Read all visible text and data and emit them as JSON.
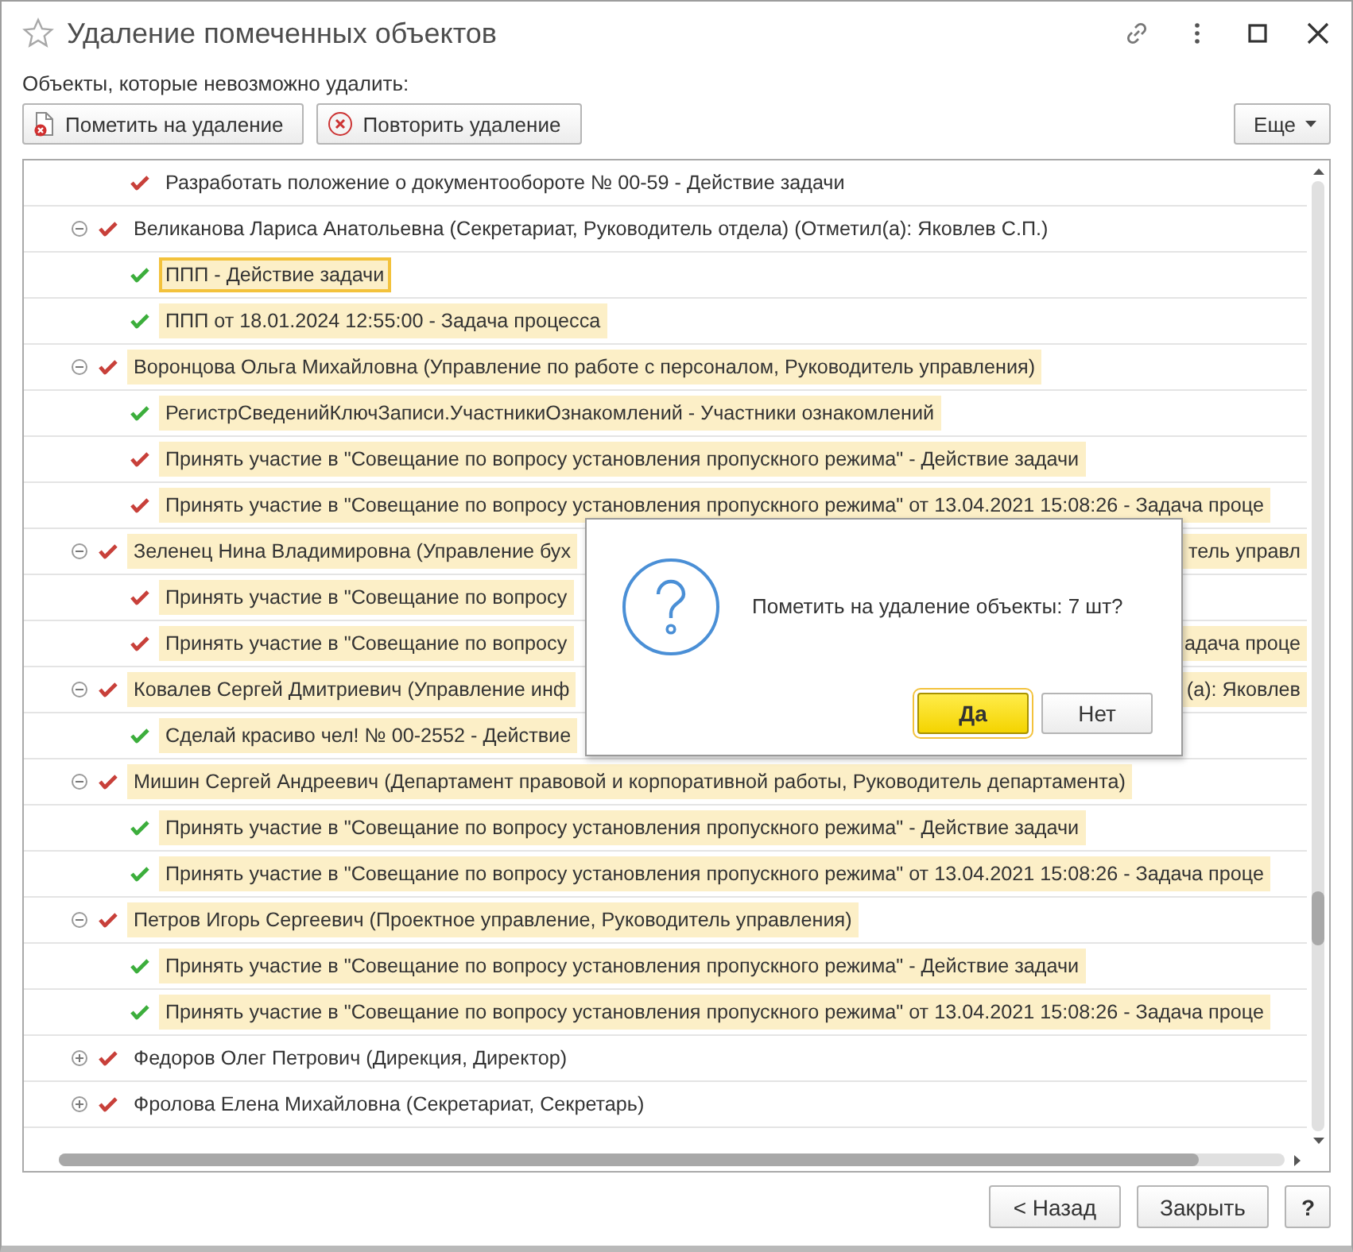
{
  "window": {
    "title": "Удаление помеченных объектов"
  },
  "section_label": "Объекты, которые невозможно удалить:",
  "toolbar": {
    "buttons": [
      {
        "label": "Пометить на удаление",
        "kind": "mark"
      },
      {
        "label": "Повторить удаление",
        "kind": "retry"
      }
    ],
    "more": "Еще"
  },
  "tree": {
    "continued_children": [
      {
        "text": "Разработать положение о документообороте № 00-59 - Действие задачи",
        "color": "#c8403a",
        "highlighted": false,
        "selected": false
      }
    ],
    "items": [
      {
        "text": "Великанова Лариса Анатольевна (Секретариат, Руководитель отдела) (Отметил(а): Яковлев С.П.)",
        "color": "#c8403a",
        "highlighted": false,
        "selected": false,
        "expanded": true,
        "children": [
          {
            "text": "ППП - Действие задачи",
            "color": "#3cae3c",
            "highlighted": true,
            "selected": true
          },
          {
            "text": "ППП от 18.01.2024 12:55:00 - Задача процесса",
            "color": "#3cae3c",
            "highlighted": true,
            "selected": false
          }
        ]
      },
      {
        "text": "Воронцова Ольга Михайловна (Управление по работе с персоналом, Руководитель управления)",
        "color": "#c8403a",
        "highlighted": true,
        "selected": false,
        "expanded": true,
        "children": [
          {
            "text": "РегистрСведенийКлючЗаписи.УчастникиОзнакомлений - Участники ознакомлений",
            "color": "#3cae3c",
            "highlighted": true,
            "selected": false
          },
          {
            "text": "Принять участие в \"Совещание по вопросу установления пропускного режима\" - Действие задачи",
            "color": "#c8403a",
            "highlighted": true,
            "selected": false
          },
          {
            "text": "Принять участие в \"Совещание по вопросу установления пропускного режима\" от 13.04.2021 15:08:26 - Задача проце",
            "color": "#c8403a",
            "highlighted": true,
            "selected": false
          }
        ]
      },
      {
        "text": "Зеленец Нина Владимировна (Управление бух",
        "text_right": "тель управл",
        "color": "#c8403a",
        "highlighted": true,
        "selected": false,
        "expanded": true,
        "children": [
          {
            "text": "Принять участие в \"Совещание по вопросу",
            "color": "#c8403a",
            "highlighted": true,
            "selected": false
          },
          {
            "text": "Принять участие в \"Совещание по вопросу",
            "text_right": "адача проце",
            "color": "#c8403a",
            "highlighted": true,
            "selected": false
          }
        ]
      },
      {
        "text": "Ковалев Сергей Дмитриевич (Управление инф",
        "text_right": "(а): Яковлев",
        "color": "#c8403a",
        "highlighted": true,
        "selected": false,
        "expanded": true,
        "children": [
          {
            "text": "Сделай красиво чел! № 00-2552 - Действие",
            "color": "#3cae3c",
            "highlighted": true,
            "selected": false
          }
        ]
      },
      {
        "text": "Мишин Сергей Андреевич (Департамент правовой и корпоративной работы, Руководитель департамента)",
        "color": "#c8403a",
        "highlighted": true,
        "selected": false,
        "expanded": true,
        "children": [
          {
            "text": "Принять участие в \"Совещание по вопросу установления пропускного режима\" - Действие задачи",
            "color": "#3cae3c",
            "highlighted": true,
            "selected": false
          },
          {
            "text": "Принять участие в \"Совещание по вопросу установления пропускного режима\" от 13.04.2021 15:08:26 - Задача проце",
            "color": "#3cae3c",
            "highlighted": true,
            "selected": false
          }
        ]
      },
      {
        "text": "Петров Игорь Сергеевич (Проектное управление, Руководитель управления)",
        "color": "#c8403a",
        "highlighted": true,
        "selected": false,
        "expanded": true,
        "children": [
          {
            "text": "Принять участие в \"Совещание по вопросу установления пропускного режима\" - Действие задачи",
            "color": "#3cae3c",
            "highlighted": true,
            "selected": false
          },
          {
            "text": "Принять участие в \"Совещание по вопросу установления пропускного режима\" от 13.04.2021 15:08:26 - Задача проце",
            "color": "#3cae3c",
            "highlighted": true,
            "selected": false
          }
        ]
      },
      {
        "text": "Федоров Олег Петрович (Дирекция, Директор)",
        "color": "#c8403a",
        "highlighted": false,
        "selected": false,
        "expanded": false
      },
      {
        "text": "Фролова Елена Михайловна (Секретариат, Секретарь)",
        "color": "#c8403a",
        "highlighted": false,
        "selected": false,
        "expanded": false
      }
    ]
  },
  "dialog": {
    "message": "Пометить на удаление объекты: 7 шт?",
    "buttons": [
      {
        "label": "Да",
        "default": true
      },
      {
        "label": "Нет",
        "default": false
      }
    ]
  },
  "footer": {
    "buttons": [
      "< Назад",
      "Закрыть",
      "?"
    ]
  }
}
